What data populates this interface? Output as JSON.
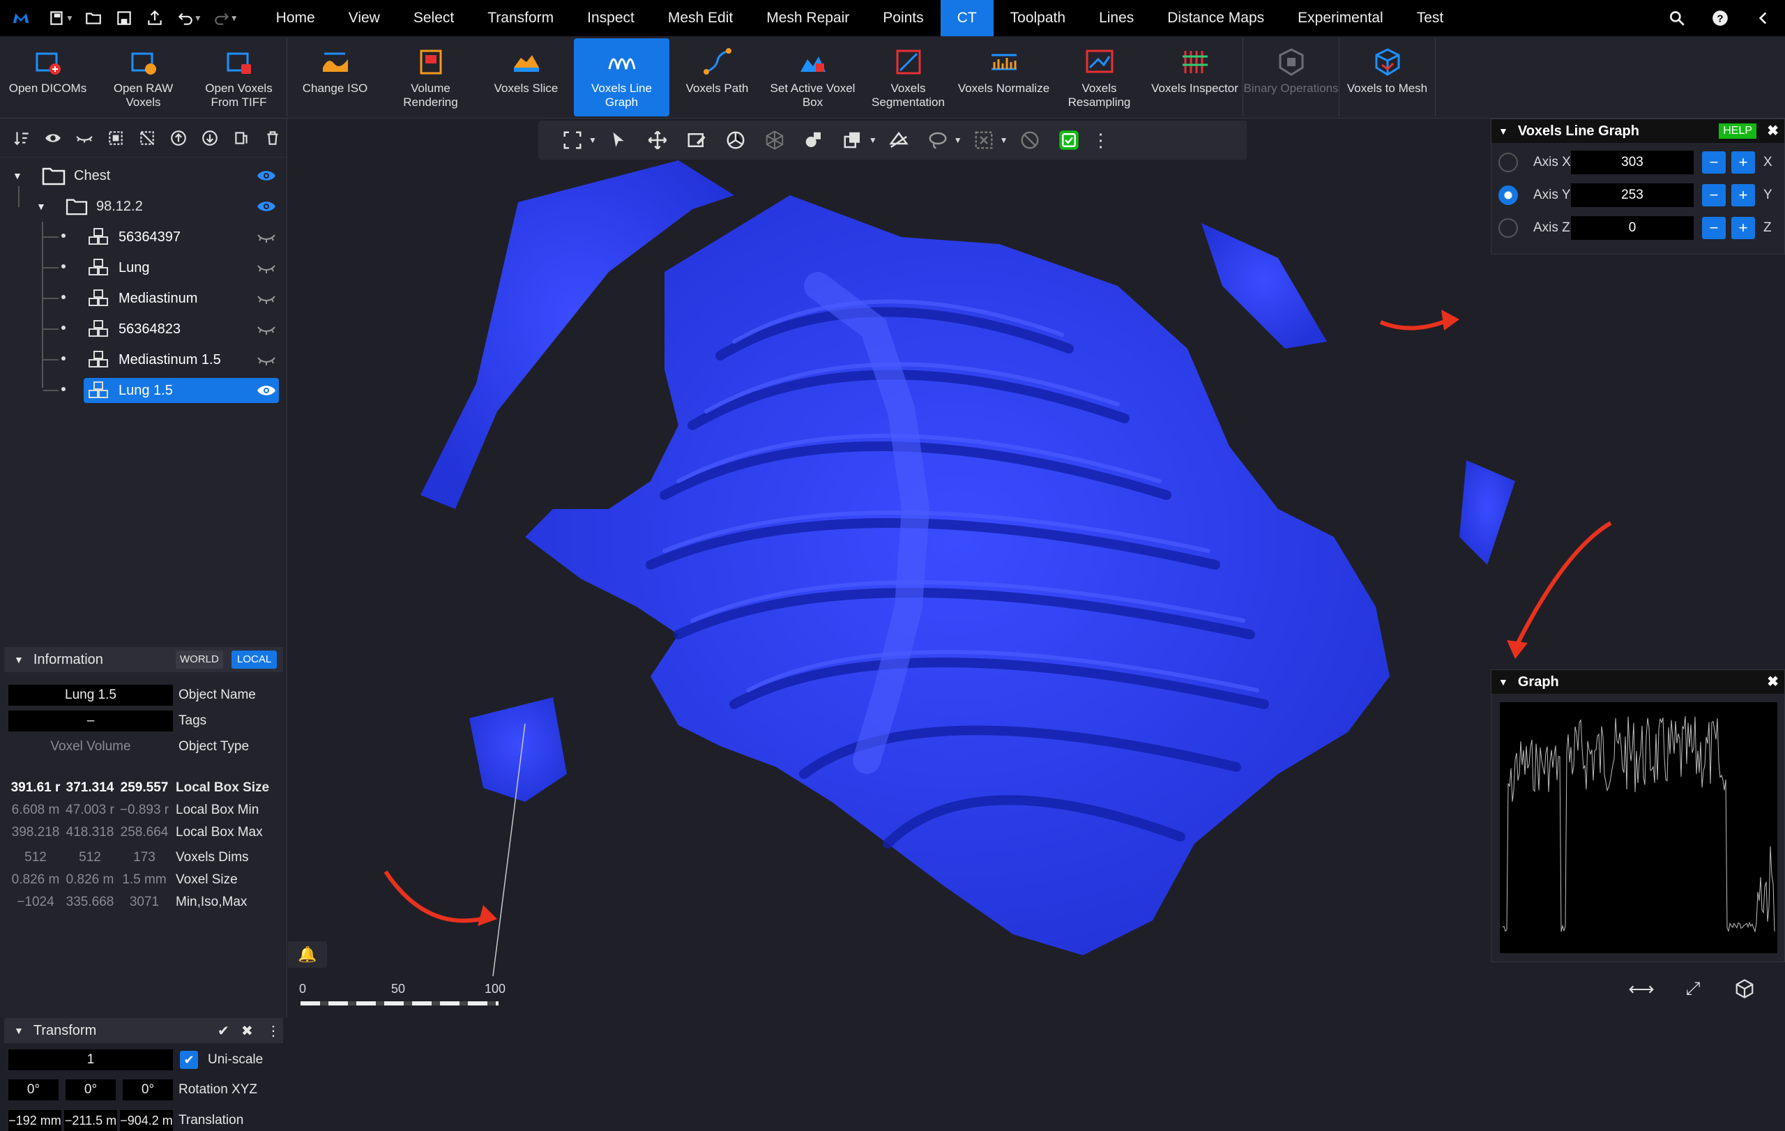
{
  "menubar": {
    "items": [
      {
        "label": "Home"
      },
      {
        "label": "View"
      },
      {
        "label": "Select"
      },
      {
        "label": "Transform"
      },
      {
        "label": "Inspect"
      },
      {
        "label": "Mesh Edit"
      },
      {
        "label": "Mesh Repair"
      },
      {
        "label": "Points"
      },
      {
        "label": "CT",
        "active": true
      },
      {
        "label": "Toolpath"
      },
      {
        "label": "Lines"
      },
      {
        "label": "Distance Maps"
      },
      {
        "label": "Experimental"
      },
      {
        "label": "Test"
      }
    ]
  },
  "ribbon": {
    "buttons": [
      {
        "label": "Open DICOMs",
        "icon": "open-dicoms-icon"
      },
      {
        "label": "Open RAW Voxels",
        "icon": "open-raw-voxels-icon"
      },
      {
        "label": "Open Voxels From TIFF",
        "icon": "open-tiff-icon"
      },
      {
        "label": "Change ISO",
        "icon": "change-iso-icon"
      },
      {
        "label": "Volume Rendering",
        "icon": "volume-rendering-icon"
      },
      {
        "label": "Voxels Slice",
        "icon": "voxels-slice-icon"
      },
      {
        "label": "Voxels Line Graph",
        "icon": "line-graph-icon",
        "active": true
      },
      {
        "label": "Voxels Path",
        "icon": "voxels-path-icon"
      },
      {
        "label": "Set Active Voxel Box",
        "icon": "voxel-box-icon"
      },
      {
        "label": "Voxels Segmentation",
        "icon": "segmentation-icon"
      },
      {
        "label": "Voxels Normalize",
        "icon": "normalize-icon"
      },
      {
        "label": "Voxels Resampling",
        "icon": "resampling-icon"
      },
      {
        "label": "Voxels Inspector",
        "icon": "inspector-icon"
      },
      {
        "label": "Binary Operations",
        "icon": "binary-ops-icon",
        "disabled": true
      },
      {
        "label": "Voxels to Mesh",
        "icon": "voxels-to-mesh-icon"
      }
    ]
  },
  "tree": {
    "root": {
      "label": "Chest"
    },
    "group": {
      "label": "98.12.2"
    },
    "items": [
      {
        "label": "56364397"
      },
      {
        "label": "Lung"
      },
      {
        "label": "Mediastinum"
      },
      {
        "label": "56364823"
      },
      {
        "label": "Mediastinum 1.5"
      },
      {
        "label": "Lung 1.5",
        "selected": true
      }
    ]
  },
  "information": {
    "title": "Information",
    "world_label": "WORLD",
    "local_label": "LOCAL",
    "object_name": "Lung 1.5",
    "object_name_label": "Object Name",
    "tags": "–",
    "tags_label": "Tags",
    "object_type": "Voxel Volume",
    "object_type_label": "Object Type",
    "box_size": [
      "391.61 r",
      "371.314",
      "259.557"
    ],
    "box_size_label": "Local Box Size",
    "box_min": [
      "6.608 m",
      "47.003 r",
      "−0.893 r"
    ],
    "box_min_label": "Local Box Min",
    "box_max": [
      "398.218",
      "418.318",
      "258.664"
    ],
    "box_max_label": "Local Box Max",
    "dims": [
      "512",
      "512",
      "173"
    ],
    "dims_label": "Voxels Dims",
    "voxel_size": [
      "0.826 m",
      "0.826 m",
      "1.5 mm"
    ],
    "voxel_size_label": "Voxel Size",
    "minisomax": [
      "−1024",
      "335.668",
      "3071"
    ],
    "minisomax_label": "Min,Iso,Max"
  },
  "transform": {
    "title": "Transform",
    "scale": "1",
    "uniscale_label": "Uni-scale",
    "rotation": [
      "0°",
      "0°",
      "0°"
    ],
    "rotation_label": "Rotation XYZ",
    "translation": [
      "−192 mm",
      "−211.5 m",
      "−904.2 m"
    ],
    "translation_label": "Translation"
  },
  "line_graph_panel": {
    "title": "Voxels Line Graph",
    "help": "HELP",
    "axes": [
      {
        "label": "Axis X",
        "value": "303",
        "suffix": "X"
      },
      {
        "label": "Axis Y",
        "value": "253",
        "suffix": "Y",
        "selected": true
      },
      {
        "label": "Axis Z",
        "value": "0",
        "suffix": "Z"
      }
    ],
    "minus": "−",
    "plus": "+"
  },
  "graph_panel": {
    "title": "Graph"
  },
  "scale_bar": {
    "ticks": [
      "0",
      "50",
      "100"
    ]
  },
  "colors": {
    "accent": "#1577e5",
    "model": "#2d3ff0",
    "bg": "#1f1f28",
    "annotation_arrow": "#e8321e"
  }
}
